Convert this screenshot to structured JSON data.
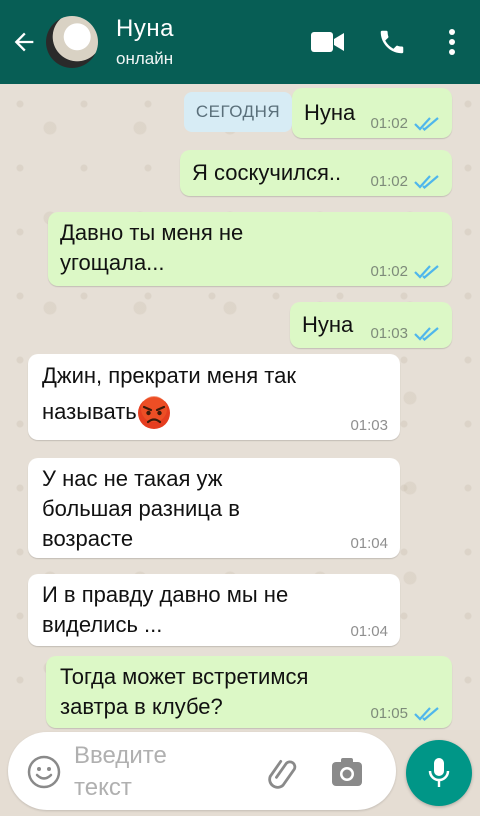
{
  "header": {
    "contact_name": "Нуна",
    "contact_status": "онлайн",
    "colors": {
      "bar": "#075e55"
    },
    "icons": [
      "back-arrow-icon",
      "video-call-icon",
      "phone-icon",
      "more-options-icon"
    ]
  },
  "chat": {
    "date_label": "СЕГОДНЯ",
    "messages": [
      {
        "direction": "out",
        "text": "Нуна",
        "time": "01:02",
        "read": true
      },
      {
        "direction": "out",
        "text": "Я соскучился..",
        "time": "01:02",
        "read": true
      },
      {
        "direction": "out",
        "text_line1": "Давно ты меня не",
        "text_line2": "угощала...",
        "time": "01:02",
        "read": true
      },
      {
        "direction": "out",
        "text": "Нуна",
        "time": "01:03",
        "read": true
      },
      {
        "direction": "in",
        "text_line1": "Джин, прекрати меня так",
        "text_line2": "называть",
        "emoji": "angry-face-emoji",
        "time": "01:03"
      },
      {
        "direction": "in",
        "text_line1": "У нас не такая уж",
        "text_line2": "большая разница в",
        "text_line3": "возрасте",
        "time": "01:04"
      },
      {
        "direction": "in",
        "text_line1": "И в правду давно мы не",
        "text_line2": "виделись ...",
        "time": "01:04"
      },
      {
        "direction": "out",
        "text_line1": "Тогда может встретимся",
        "text_line2": "завтра в клубе?",
        "time": "01:05",
        "read": true
      }
    ],
    "colors": {
      "outgoing": "#dcf8c6",
      "incoming": "#ffffff",
      "read_ticks": "#4fb6ec"
    }
  },
  "composer": {
    "placeholder_line1": "Введите",
    "placeholder_line2": "текст",
    "icons": [
      "emoji-icon",
      "attach-icon",
      "camera-icon",
      "mic-icon"
    ],
    "colors": {
      "mic_button": "#009687"
    }
  }
}
